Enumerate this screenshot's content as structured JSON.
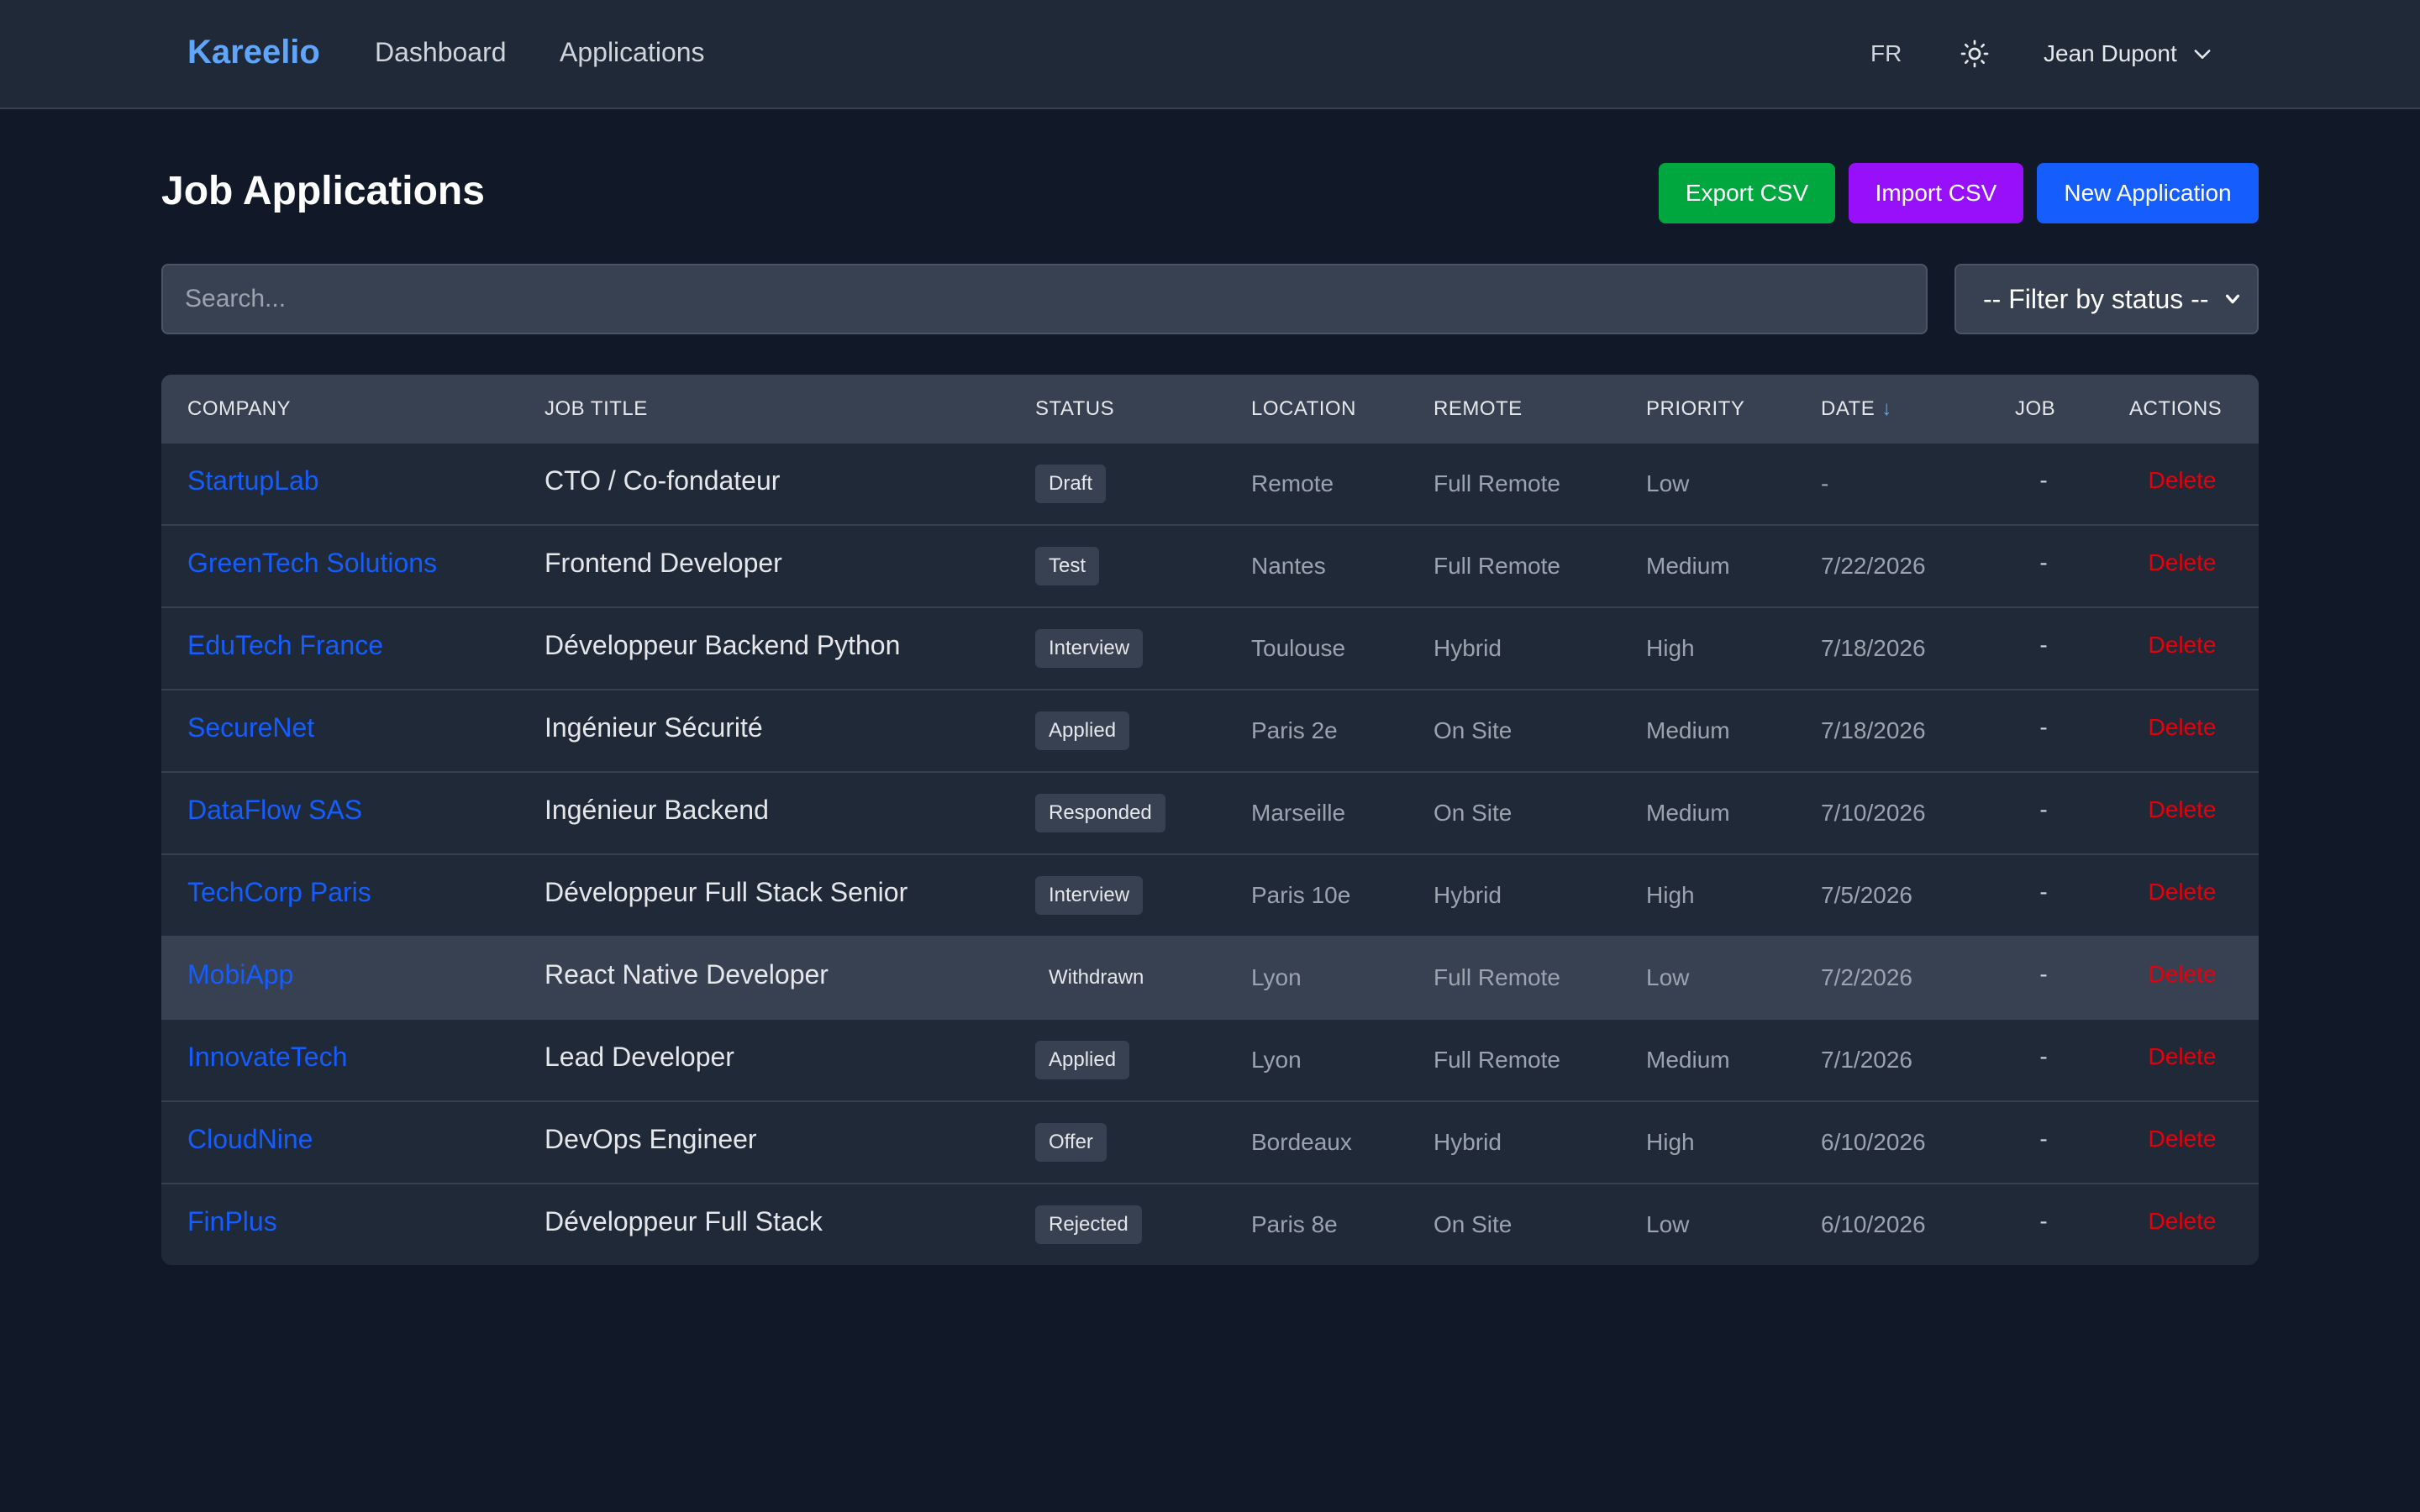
{
  "navbar": {
    "brand": "Kareelio",
    "links": [
      "Dashboard",
      "Applications"
    ],
    "language": "FR",
    "theme_icon": "sun-icon",
    "user_name": "Jean Dupont",
    "user_menu_icon": "chevron-down-icon"
  },
  "page": {
    "title": "Job Applications",
    "export_label": "Export CSV",
    "import_label": "Import CSV",
    "new_label": "New Application",
    "search_placeholder": "Search...",
    "status_filter": "-- Filter by status --"
  },
  "table": {
    "headers": {
      "company": "COMPANY",
      "job_title": "JOB TITLE",
      "status": "STATUS",
      "location": "LOCATION",
      "remote": "REMOTE",
      "priority": "PRIORITY",
      "date": "DATE",
      "date_sort": "↓",
      "job": "JOB",
      "actions": "ACTIONS"
    },
    "rows": [
      {
        "company": "StartupLab",
        "title": "CTO / Co-fondateur",
        "status": "Draft",
        "location": "Remote",
        "remote": "Full Remote",
        "priority": "Low",
        "date": "-",
        "job": "-",
        "action": "Delete"
      },
      {
        "company": "GreenTech Solutions",
        "title": "Frontend Developer",
        "status": "Test",
        "location": "Nantes",
        "remote": "Full Remote",
        "priority": "Medium",
        "date": "7/22/2026",
        "job": "-",
        "action": "Delete"
      },
      {
        "company": "EduTech France",
        "title": "Développeur Backend Python",
        "status": "Interview",
        "location": "Toulouse",
        "remote": "Hybrid",
        "priority": "High",
        "date": "7/18/2026",
        "job": "-",
        "action": "Delete"
      },
      {
        "company": "SecureNet",
        "title": "Ingénieur Sécurité",
        "status": "Applied",
        "location": "Paris 2e",
        "remote": "On Site",
        "priority": "Medium",
        "date": "7/18/2026",
        "job": "-",
        "action": "Delete"
      },
      {
        "company": "DataFlow SAS",
        "title": "Ingénieur Backend",
        "status": "Responded",
        "location": "Marseille",
        "remote": "On Site",
        "priority": "Medium",
        "date": "7/10/2026",
        "job": "-",
        "action": "Delete"
      },
      {
        "company": "TechCorp Paris",
        "title": "Développeur Full Stack Senior",
        "status": "Interview",
        "location": "Paris 10e",
        "remote": "Hybrid",
        "priority": "High",
        "date": "7/5/2026",
        "job": "-",
        "action": "Delete"
      },
      {
        "company": "MobiApp",
        "title": "React Native Developer",
        "status": "Withdrawn",
        "location": "Lyon",
        "remote": "Full Remote",
        "priority": "Low",
        "date": "7/2/2026",
        "job": "-",
        "action": "Delete"
      },
      {
        "company": "InnovateTech",
        "title": "Lead Developer",
        "status": "Applied",
        "location": "Lyon",
        "remote": "Full Remote",
        "priority": "Medium",
        "date": "7/1/2026",
        "job": "-",
        "action": "Delete"
      },
      {
        "company": "CloudNine",
        "title": "DevOps Engineer",
        "status": "Offer",
        "location": "Bordeaux",
        "remote": "Hybrid",
        "priority": "High",
        "date": "6/10/2026",
        "job": "-",
        "action": "Delete"
      },
      {
        "company": "FinPlus",
        "title": "Développeur Full Stack",
        "status": "Rejected",
        "location": "Paris 8e",
        "remote": "On Site",
        "priority": "Low",
        "date": "6/10/2026",
        "job": "-",
        "action": "Delete"
      }
    ]
  }
}
